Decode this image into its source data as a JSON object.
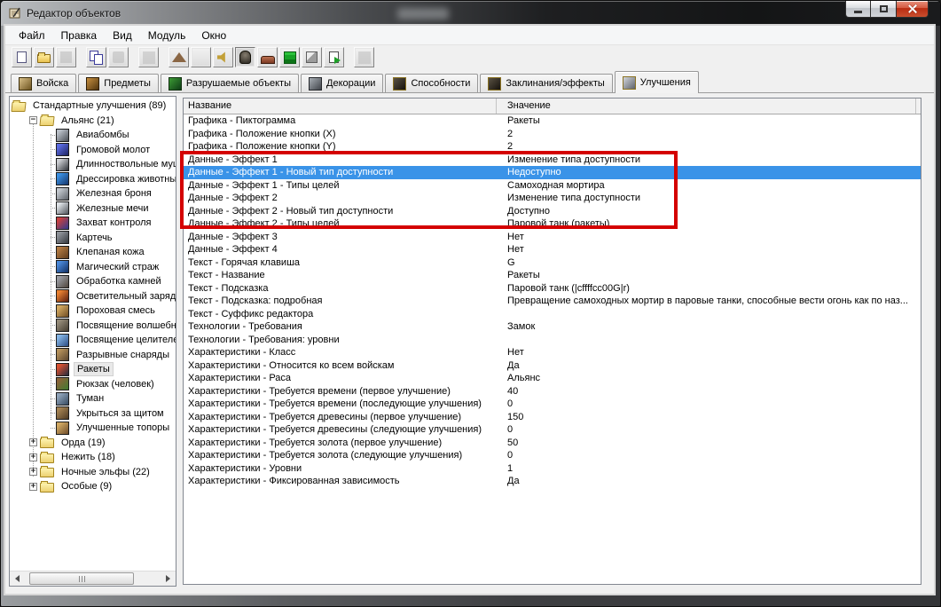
{
  "window": {
    "title": "Редактор объектов",
    "controls": {
      "minimize": "minimize",
      "maximize": "maximize",
      "close": "close"
    }
  },
  "menu": {
    "items": [
      "Файл",
      "Правка",
      "Вид",
      "Модуль",
      "Окно"
    ]
  },
  "toolbar": {
    "buttons": [
      {
        "name": "new-map",
        "icon": "page",
        "enabled": true,
        "gap": false
      },
      {
        "name": "open-map",
        "icon": "folder",
        "enabled": true,
        "gap": false
      },
      {
        "name": "save-map",
        "icon": "save",
        "enabled": false,
        "gap": false
      },
      {
        "name": "copy",
        "icon": "copy",
        "enabled": true,
        "gap": true
      },
      {
        "name": "paste",
        "icon": "paste",
        "enabled": false,
        "gap": false
      },
      {
        "name": "undo",
        "icon": "blank",
        "enabled": false,
        "gap": true
      },
      {
        "name": "terrain-editor",
        "icon": "mountain",
        "enabled": true,
        "gap": true
      },
      {
        "name": "trigger-editor",
        "icon": "letter-a",
        "enabled": true,
        "gap": false
      },
      {
        "name": "sound-editor",
        "icon": "speaker",
        "enabled": true,
        "gap": false
      },
      {
        "name": "object-editor",
        "icon": "object",
        "enabled": true,
        "pressed": true,
        "gap": false
      },
      {
        "name": "campaign-editor",
        "icon": "campaign",
        "enabled": true,
        "gap": false
      },
      {
        "name": "ai-editor",
        "icon": "ai",
        "enabled": true,
        "gap": false
      },
      {
        "name": "object-manager",
        "icon": "cube",
        "enabled": true,
        "gap": false
      },
      {
        "name": "import-manager",
        "icon": "import",
        "enabled": true,
        "gap": false
      },
      {
        "name": "test-map",
        "icon": "test",
        "enabled": false,
        "gap": true
      }
    ]
  },
  "tabs": {
    "active_index": 6,
    "items": [
      {
        "label": "Войска",
        "icon": "units-icon",
        "c1": "#d9c088",
        "c2": "#6e5420",
        "border": "#3c2e0c"
      },
      {
        "label": "Предметы",
        "icon": "items-icon",
        "c1": "#c89040",
        "c2": "#50340e",
        "border": "#2c1c06"
      },
      {
        "label": "Разрушаемые объекты",
        "icon": "destructibles-icon",
        "c1": "#3c9a34",
        "c2": "#0e3c16",
        "border": "#123010"
      },
      {
        "label": "Декорации",
        "icon": "doodads-icon",
        "c1": "#a8aeb4",
        "c2": "#40444a",
        "border": "#26282c"
      },
      {
        "label": "Способности",
        "icon": "abilities-icon",
        "c1": "#5a5244",
        "c2": "#16120c",
        "border": "#8a7222"
      },
      {
        "label": "Заклинания/эффекты",
        "icon": "buffs-icon",
        "c1": "#5a5244",
        "c2": "#16120c",
        "border": "#8a7222"
      },
      {
        "label": "Улучшения",
        "icon": "upgrades-icon",
        "c1": "#d2d6dc",
        "c2": "#5e626a",
        "border": "#8a7222"
      }
    ]
  },
  "tree": {
    "root": {
      "label": "Стандартные улучшения (89)"
    },
    "selected_label": "Ракеты",
    "alliance": {
      "label": "Альянс (21)",
      "expander": "minus",
      "items": [
        {
          "label": "Авиабомбы",
          "c1": "#b8bec6",
          "c2": "#4a4f56"
        },
        {
          "label": "Громовой молот",
          "c1": "#5a6ae0",
          "c2": "#1c2260"
        },
        {
          "label": "Длинноствольные мушкеты",
          "c1": "#caccd0",
          "c2": "#2e3238"
        },
        {
          "label": "Дрессировка животных",
          "c1": "#3a8fe0",
          "c2": "#16356a"
        },
        {
          "label": "Железная броня",
          "c1": "#c2c7cd",
          "c2": "#5c6168"
        },
        {
          "label": "Железные мечи",
          "c1": "#dde1e5",
          "c2": "#50555c"
        },
        {
          "label": "Захват контроля",
          "c1": "#c84040",
          "c2": "#2c3a90"
        },
        {
          "label": "Картечь",
          "c1": "#8e9298",
          "c2": "#34383e"
        },
        {
          "label": "Клепаная кожа",
          "c1": "#b07840",
          "c2": "#5e3c1c"
        },
        {
          "label": "Магический страж",
          "c1": "#4a88d8",
          "c2": "#102e62"
        },
        {
          "label": "Обработка камней",
          "c1": "#989aa0",
          "c2": "#4e443a"
        },
        {
          "label": "Осветительный заряд",
          "c1": "#e88030",
          "c2": "#581c0e"
        },
        {
          "label": "Пороховая смесь",
          "c1": "#d2a860",
          "c2": "#6e4c24"
        },
        {
          "label": "Посвящение волшебниц",
          "c1": "#948a78",
          "c2": "#443c30"
        },
        {
          "label": "Посвящение целителей",
          "c1": "#84b4e4",
          "c2": "#2c4c82"
        },
        {
          "label": "Разрывные снаряды",
          "c1": "#b4905a",
          "c2": "#594430"
        },
        {
          "label": "Ракеты",
          "c1": "#d85030",
          "c2": "#242c3e"
        },
        {
          "label": "Рюкзак (человек)",
          "c1": "#8a6438",
          "c2": "#3e7a30"
        },
        {
          "label": "Туман",
          "c1": "#8ea2b8",
          "c2": "#364a60"
        },
        {
          "label": "Укрыться за щитом",
          "c1": "#a48252",
          "c2": "#4e3a24"
        },
        {
          "label": "Улучшенные топоры",
          "c1": "#d0a862",
          "c2": "#6e4c2a"
        }
      ]
    },
    "folders": [
      {
        "label": "Орда (19)",
        "expander": "plus"
      },
      {
        "label": "Нежить (18)",
        "expander": "plus"
      },
      {
        "label": "Ночные эльфы (22)",
        "expander": "plus"
      },
      {
        "label": "Особые (9)",
        "expander": "plus"
      }
    ]
  },
  "table": {
    "columns": [
      "Название",
      "Значение"
    ],
    "selected_index": 4,
    "rows": [
      [
        "Графика - Пиктограмма",
        "Ракеты"
      ],
      [
        "Графика - Положение кнопки (X)",
        "2"
      ],
      [
        "Графика - Положение кнопки (Y)",
        "2"
      ],
      [
        "Данные - Эффект 1",
        "Изменение типа доступности"
      ],
      [
        "Данные - Эффект 1 - Новый тип доступности",
        "Недоступно"
      ],
      [
        "Данные - Эффект 1 - Типы целей",
        "Самоходная мортира"
      ],
      [
        "Данные - Эффект 2",
        "Изменение типа доступности"
      ],
      [
        "Данные - Эффект 2 - Новый тип доступности",
        "Доступно"
      ],
      [
        "Данные - Эффект 2 - Типы целей",
        "Паровой танк (ракеты)"
      ],
      [
        "Данные - Эффект 3",
        "Нет"
      ],
      [
        "Данные - Эффект 4",
        "Нет"
      ],
      [
        "Текст - Горячая клавиша",
        "G"
      ],
      [
        "Текст - Название",
        "Ракеты"
      ],
      [
        "Текст - Подсказка",
        "Паровой танк (|cffffcc00G|r)"
      ],
      [
        "Текст - Подсказка: подробная",
        "Превращение самоходных мортир в паровые танки, способные вести огонь как по наз..."
      ],
      [
        "Текст - Суффикс редактора",
        ""
      ],
      [
        "Технологии - Требования",
        "Замок"
      ],
      [
        "Технологии - Требования: уровни",
        ""
      ],
      [
        "Характеристики - Класс",
        "Нет"
      ],
      [
        "Характеристики - Относится ко всем войскам",
        "Да"
      ],
      [
        "Характеристики - Раса",
        "Альянс"
      ],
      [
        "Характеристики - Требуется времени (первое улучшение)",
        "40"
      ],
      [
        "Характеристики - Требуется времени (последующие улучшения)",
        "0"
      ],
      [
        "Характеристики - Требуется древесины (первое улучшение)",
        "150"
      ],
      [
        "Характеристики - Требуется древесины (следующие улучшения)",
        "0"
      ],
      [
        "Характеристики - Требуется золота (первое улучшение)",
        "50"
      ],
      [
        "Характеристики - Требуется золота (следующие улучшения)",
        "0"
      ],
      [
        "Характеристики - Уровни",
        "1"
      ],
      [
        "Характеристики - Фиксированная зависимость",
        "Да"
      ]
    ]
  },
  "annotation": {
    "color": "#d40000",
    "covers_rows": "Данные - Эффект 1 ... Данные - Эффект 2 - Типы целей"
  },
  "colors": {
    "selection": "#3a93e8",
    "selection_text": "#ffffff"
  }
}
